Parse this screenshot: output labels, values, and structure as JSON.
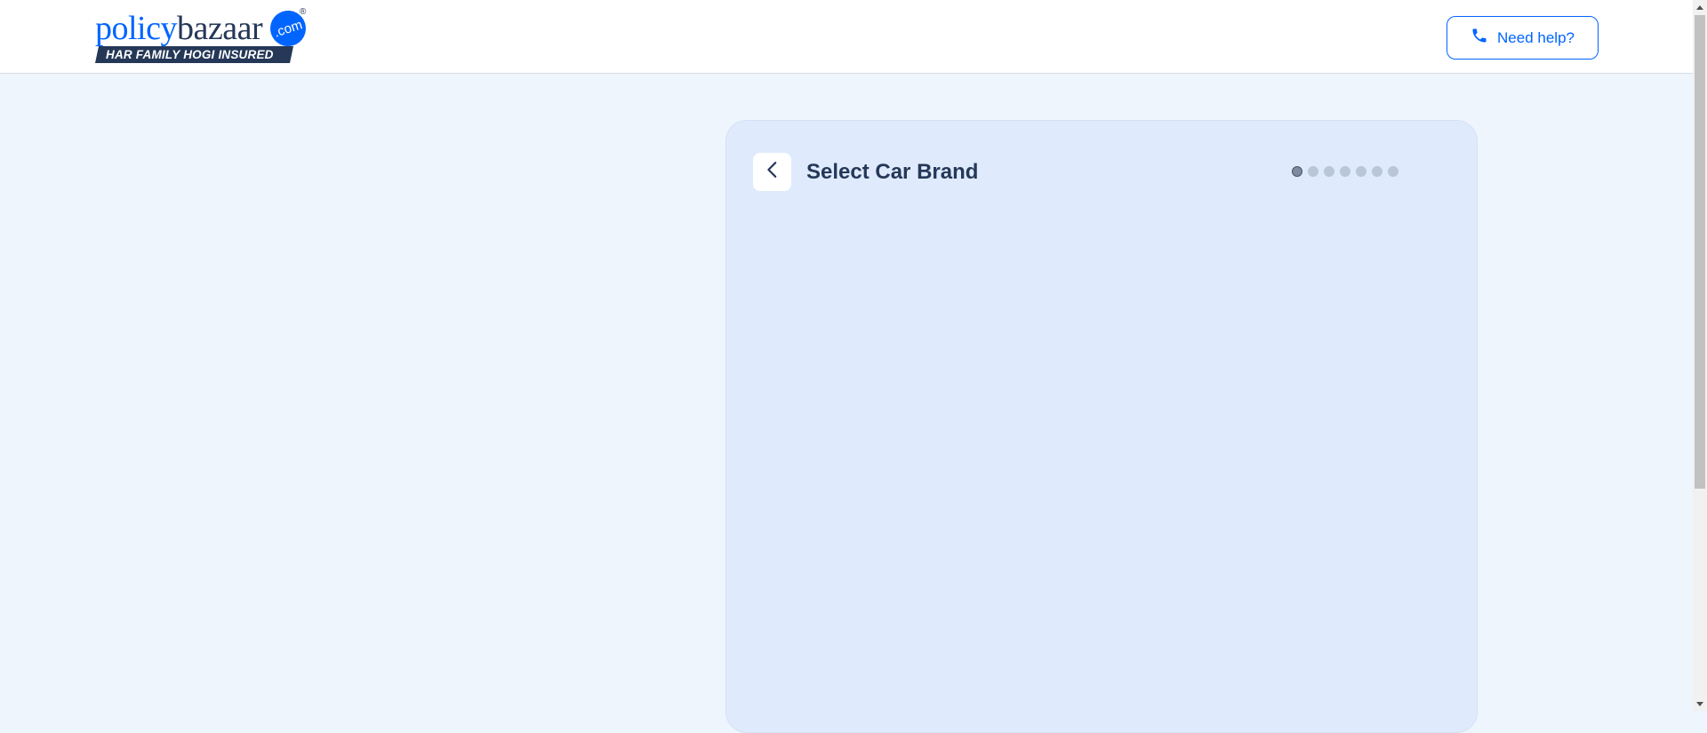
{
  "header": {
    "logo": {
      "word_part1": "policy",
      "word_part2": "bazaar",
      "com_badge": ".com",
      "registered": "®",
      "tagline": "HAR FAMILY HOGI INSURED"
    },
    "help_button": {
      "icon": "phone-icon",
      "label": "Need help?"
    }
  },
  "card": {
    "back_icon": "chevron-left-icon",
    "title": "Select Car Brand",
    "steps": {
      "total": 7,
      "current": 1
    }
  },
  "colors": {
    "brand_blue": "#0065ff",
    "brand_navy": "#253858",
    "page_bg": "#eff5fd",
    "card_bg": "#dfebfc"
  }
}
